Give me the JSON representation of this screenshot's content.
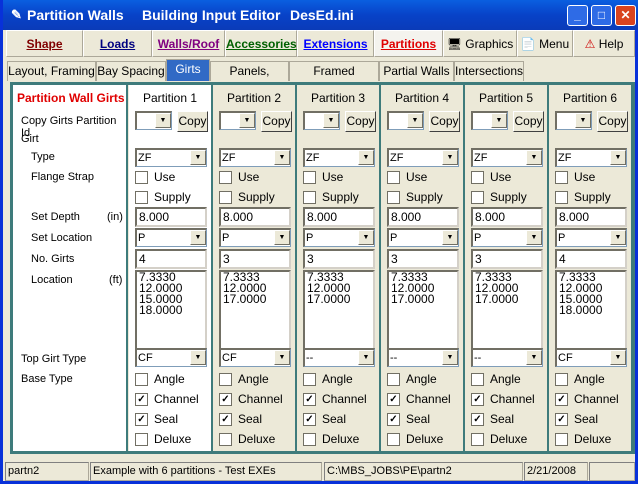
{
  "window": {
    "title": "Partition Walls",
    "subtitle": "Building Input Editor",
    "file": "DesEd.ini"
  },
  "main_tabs": [
    {
      "label": "Shape",
      "color": "#800000"
    },
    {
      "label": "Loads",
      "color": "#000080"
    },
    {
      "label": "Walls/Roof",
      "color": "#800080"
    },
    {
      "label": "Accessories",
      "color": "#006000"
    },
    {
      "label": "Extensions",
      "color": "#0000ff"
    },
    {
      "label": "Partitions",
      "color": "#e00000"
    }
  ],
  "tool_buttons": {
    "graphics": "Graphics",
    "menu": "Menu",
    "help": "Help"
  },
  "sub_tabs": [
    "Layout, Framing",
    "Bay Spacing",
    "Girts",
    "Panels, Colors",
    "Framed Openings",
    "Partial Walls",
    "Intersections"
  ],
  "labels": {
    "heading": "Partition Wall Girts",
    "copy": "Copy Girts Partition Id",
    "girt": "Girt",
    "type": "Type",
    "flange": "Flange Strap",
    "depth": "Set Depth",
    "depth_unit": "(in)",
    "set_location": "Set Location",
    "no_girts": "No. Girts",
    "location": "Location",
    "location_unit": "(ft)",
    "top_girt": "Top Girt Type",
    "base_type": "Base Type"
  },
  "copy_label": "Copy",
  "check_labels": {
    "use": "Use",
    "supply": "Supply",
    "angle": "Angle",
    "channel": "Channel",
    "seal": "Seal",
    "deluxe": "Deluxe"
  },
  "partitions": [
    {
      "name": "Partition 1",
      "type": "ZF",
      "use": false,
      "supply": false,
      "depth": "8.000",
      "set_location": "P",
      "no_girts": "4",
      "locations": [
        "7.3330",
        "12.0000",
        "15.0000",
        "18.0000"
      ],
      "top_girt": "CF",
      "angle": false,
      "channel": true,
      "seal": true,
      "deluxe": false
    },
    {
      "name": "Partition 2",
      "type": "ZF",
      "use": false,
      "supply": false,
      "depth": "8.000",
      "set_location": "P",
      "no_girts": "3",
      "locations": [
        "7.3333",
        "12.0000",
        "17.0000"
      ],
      "top_girt": "CF",
      "angle": false,
      "channel": true,
      "seal": true,
      "deluxe": false
    },
    {
      "name": "Partition 3",
      "type": "ZF",
      "use": false,
      "supply": false,
      "depth": "8.000",
      "set_location": "P",
      "no_girts": "3",
      "locations": [
        "7.3333",
        "12.0000",
        "17.0000"
      ],
      "top_girt": "--",
      "angle": false,
      "channel": true,
      "seal": true,
      "deluxe": false
    },
    {
      "name": "Partition 4",
      "type": "ZF",
      "use": false,
      "supply": false,
      "depth": "8.000",
      "set_location": "P",
      "no_girts": "3",
      "locations": [
        "7.3333",
        "12.0000",
        "17.0000"
      ],
      "top_girt": "--",
      "angle": false,
      "channel": true,
      "seal": true,
      "deluxe": false
    },
    {
      "name": "Partition 5",
      "type": "ZF",
      "use": false,
      "supply": false,
      "depth": "8.000",
      "set_location": "P",
      "no_girts": "3",
      "locations": [
        "7.3333",
        "12.0000",
        "17.0000"
      ],
      "top_girt": "--",
      "angle": false,
      "channel": true,
      "seal": true,
      "deluxe": false
    },
    {
      "name": "Partition 6",
      "type": "ZF",
      "use": false,
      "supply": false,
      "depth": "8.000",
      "set_location": "P",
      "no_girts": "4",
      "locations": [
        "7.3333",
        "12.0000",
        "15.0000",
        "18.0000"
      ],
      "top_girt": "CF",
      "angle": false,
      "channel": true,
      "seal": true,
      "deluxe": false
    }
  ],
  "status": {
    "job": "partn2",
    "description": "Example with 6 partitions - Test EXEs",
    "path": "C:\\MBS_JOBS\\PE\\partn2",
    "date": "2/21/2008"
  }
}
